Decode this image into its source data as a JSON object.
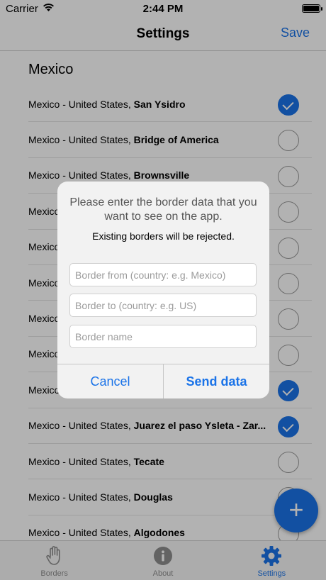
{
  "status": {
    "carrier": "Carrier",
    "time": "2:44 PM"
  },
  "nav": {
    "title": "Settings",
    "save_label": "Save"
  },
  "section_title": "Mexico",
  "borders": [
    {
      "prefix": "Mexico - United States,",
      "name": "San Ysidro",
      "checked": true
    },
    {
      "prefix": "Mexico - United States,",
      "name": "Bridge of America",
      "checked": false
    },
    {
      "prefix": "Mexico - United States,",
      "name": "Brownsville",
      "checked": false
    },
    {
      "prefix": "Mexico",
      "name": "",
      "checked": false
    },
    {
      "prefix": "Mexico",
      "name": "",
      "checked": false
    },
    {
      "prefix": "Mexico",
      "name": "",
      "checked": false
    },
    {
      "prefix": "Mexico",
      "name": "",
      "checked": false
    },
    {
      "prefix": "Mexico",
      "name": "",
      "checked": false
    },
    {
      "prefix": "Mexico",
      "name": "",
      "checked": true
    },
    {
      "prefix": "Mexico - United States,",
      "name": "Juarez el paso Ysleta - Zar...",
      "checked": true
    },
    {
      "prefix": "Mexico - United States,",
      "name": "Tecate",
      "checked": false
    },
    {
      "prefix": "Mexico - United States,",
      "name": "Douglas",
      "checked": false
    },
    {
      "prefix": "Mexico - United States,",
      "name": "Algodones",
      "checked": false
    }
  ],
  "fab_label": "+",
  "tabs": [
    {
      "label": "Borders",
      "icon": "hand-icon",
      "active": false
    },
    {
      "label": "About",
      "icon": "info-icon",
      "active": false
    },
    {
      "label": "Settings",
      "icon": "gear-icon",
      "active": true
    }
  ],
  "alert": {
    "title": "Please enter the border data that you want to see on the app.",
    "message": "Existing borders will be rejected.",
    "from_placeholder": "Border from (country: e.g. Mexico)",
    "to_placeholder": "Border to (country: e.g. US)",
    "name_placeholder": "Border name",
    "cancel_label": "Cancel",
    "send_label": "Send data"
  },
  "colors": {
    "accent": "#1a73e8",
    "inactive_tab": "#8e8e8e"
  }
}
